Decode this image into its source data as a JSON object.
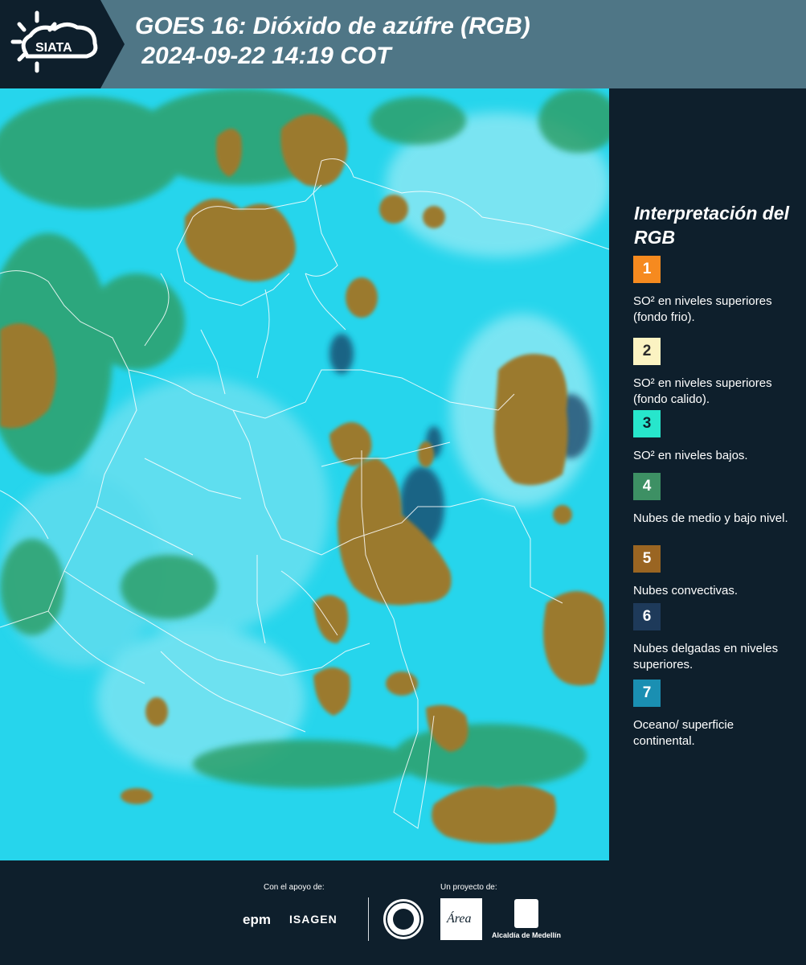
{
  "header": {
    "title": "GOES 16: Dióxido de azúfre (RGB)\n 2024-09-22 14:19 COT",
    "logo_text": "SIATA"
  },
  "colors": {
    "background": "#0e1f2c",
    "header_band": "#4f7686",
    "ocean": "#27d7ec",
    "clouds_convective": "#9b7a2f",
    "clouds_low": "#2b9d67",
    "borders": "#ffffff"
  },
  "legend": {
    "title": "Interpretación del RGB",
    "items": [
      {
        "num": "1",
        "color": "#f68a1f",
        "num_color": "#ffffff",
        "text": "SO² en niveles superiores (fondo frio)."
      },
      {
        "num": "2",
        "color": "#fbf3c2",
        "num_color": "#2a2a2a",
        "text": "SO² en niveles superiores (fondo calido)."
      },
      {
        "num": "3",
        "color": "#27e6cc",
        "num_color": "#0e1f2c",
        "text": "SO² en niveles bajos."
      },
      {
        "num": "4",
        "color": "#3d9064",
        "num_color": "#ffffff",
        "text": "Nubes de medio y bajo nivel."
      },
      {
        "num": "5",
        "color": "#9a6522",
        "num_color": "#ffffff",
        "text": "Nubes convectivas."
      },
      {
        "num": "6",
        "color": "#1e3a5a",
        "num_color": "#ffffff",
        "text": "Nubes delgadas en niveles superiores."
      },
      {
        "num": "7",
        "color": "#1a8fb2",
        "num_color": "#ffffff",
        "text": "Oceano/ superficie continental."
      }
    ]
  },
  "footer": {
    "support_label": "Con el apoyo de:",
    "project_label": "Un proyecto de:",
    "sponsors": [
      "epm",
      "ISAGEN"
    ],
    "partners": [
      "Área Metropolitana Valle de Aburrá",
      "Alcaldía de Medellín"
    ],
    "epm_text": "epm",
    "isagen_text": "ISAGEN",
    "area_text": "Área",
    "alcaldia_text": "Alcaldía de Medellín"
  }
}
